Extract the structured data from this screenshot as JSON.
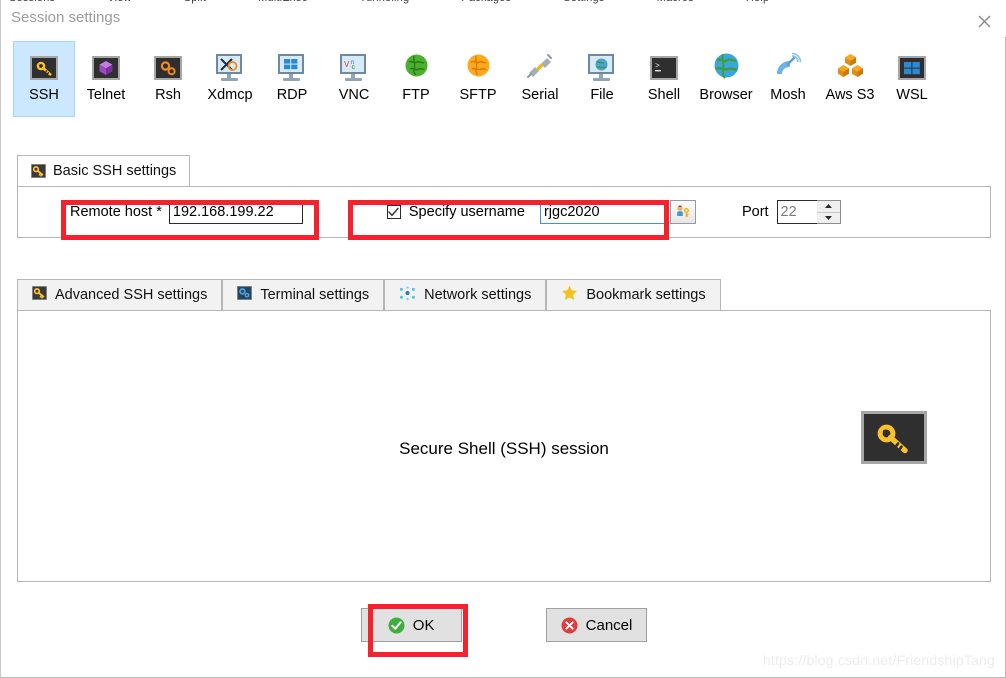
{
  "window": {
    "title": "Session settings",
    "close_icon": "close-icon",
    "clipped_top_items": [
      "Sessions",
      "View",
      "Split",
      "MultiExec",
      "Tunneling",
      "Packages",
      "Settings",
      "Macros",
      "Help"
    ]
  },
  "protocols": [
    {
      "label": "SSH",
      "icon": "ssh-key-icon",
      "selected": true
    },
    {
      "label": "Telnet",
      "icon": "telnet-cube-icon",
      "selected": false
    },
    {
      "label": "Rsh",
      "icon": "rsh-gears-icon",
      "selected": false
    },
    {
      "label": "Xdmcp",
      "icon": "xdmcp-monitor-icon",
      "selected": false
    },
    {
      "label": "RDP",
      "icon": "rdp-windows-monitor-icon",
      "selected": false
    },
    {
      "label": "VNC",
      "icon": "vnc-monitor-icon",
      "selected": false
    },
    {
      "label": "FTP",
      "icon": "ftp-green-globe-icon",
      "selected": false
    },
    {
      "label": "SFTP",
      "icon": "sftp-orange-globe-icon",
      "selected": false
    },
    {
      "label": "Serial",
      "icon": "serial-plug-icon",
      "selected": false
    },
    {
      "label": "File",
      "icon": "file-monitor-globe-icon",
      "selected": false
    },
    {
      "label": "Shell",
      "icon": "shell-terminal-icon",
      "selected": false
    },
    {
      "label": "Browser",
      "icon": "browser-globe-icon",
      "selected": false
    },
    {
      "label": "Mosh",
      "icon": "mosh-satellite-icon",
      "selected": false
    },
    {
      "label": "Aws S3",
      "icon": "aws-s3-cubes-icon",
      "selected": false
    },
    {
      "label": "WSL",
      "icon": "wsl-windows-icon",
      "selected": false
    }
  ],
  "basic_tab": {
    "label": "Basic SSH settings",
    "icon": "key-icon"
  },
  "form": {
    "remote_host_label": "Remote host *",
    "remote_host_value": "192.168.199.22",
    "specify_username_label": "Specify username",
    "specify_username_checked": true,
    "username_value": "rjgc2020",
    "username_button_icon": "user-key-icon",
    "port_label": "Port",
    "port_value": "22",
    "port_spinner_up_icon": "spinner-up-icon",
    "port_spinner_down_icon": "spinner-down-icon"
  },
  "lower_tabs": [
    {
      "label": "Advanced SSH settings",
      "icon": "key-icon"
    },
    {
      "label": "Terminal settings",
      "icon": "terminal-gear-icon"
    },
    {
      "label": "Network settings",
      "icon": "network-dots-icon"
    },
    {
      "label": "Bookmark settings",
      "icon": "star-icon"
    }
  ],
  "content": {
    "session_text": "Secure Shell (SSH) session",
    "big_icon": "ssh-key-icon"
  },
  "buttons": {
    "ok_label": "OK",
    "ok_icon": "green-check-icon",
    "cancel_label": "Cancel",
    "cancel_icon": "red-x-icon"
  },
  "watermark": "https://blog.csdn.net/FriendshipTang",
  "colors": {
    "selection_blue": "#cce8ff",
    "annotation_red": "#f5222d",
    "key_yellow": "#fbc02d",
    "ok_green": "#3fae3f",
    "cancel_red": "#e23b3b",
    "title_gray": "#9b9b9b"
  }
}
